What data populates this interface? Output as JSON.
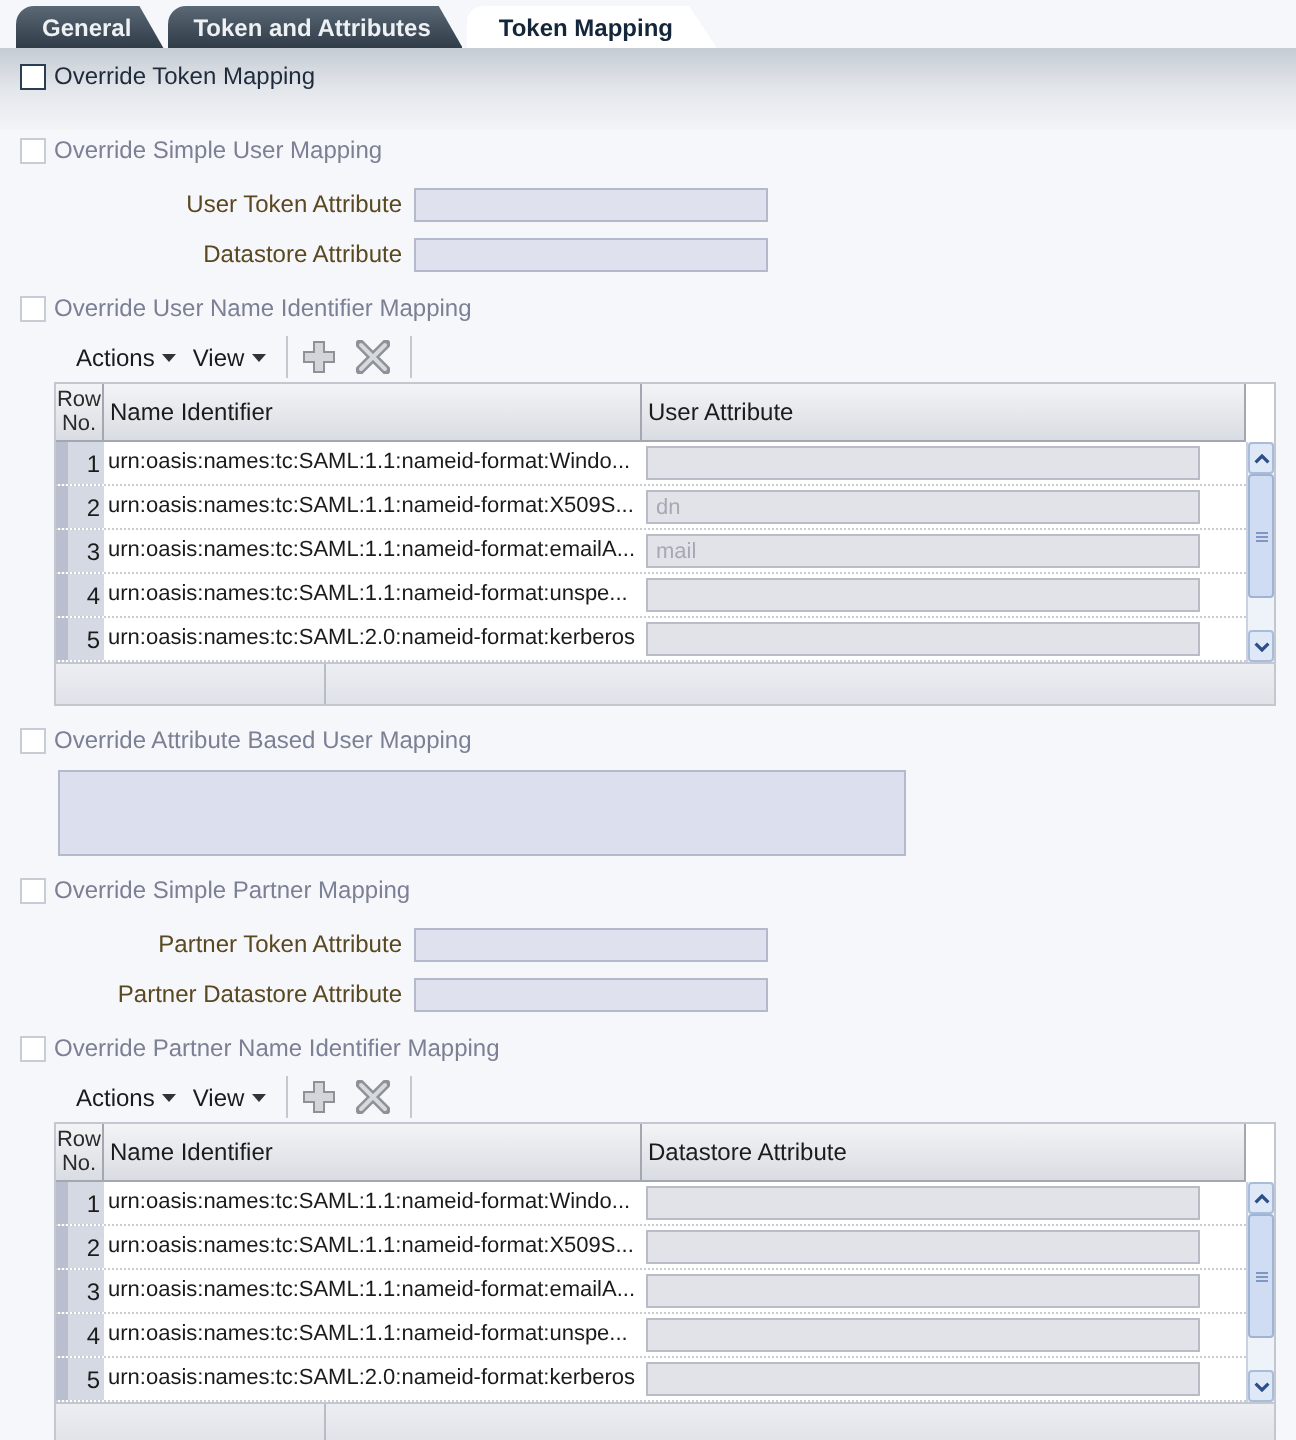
{
  "tabs": [
    {
      "label": "General",
      "selected": false
    },
    {
      "label": "Token and Attributes",
      "selected": false
    },
    {
      "label": "Token Mapping",
      "selected": true
    }
  ],
  "header": {
    "label": "Override Token Mapping",
    "checked": false,
    "disabled": false
  },
  "sections": [
    {
      "kind": "fields",
      "label": "Override Simple User Mapping",
      "checked": false,
      "disabled": true,
      "fields": [
        {
          "label": "User Token Attribute"
        },
        {
          "label": "Datastore Attribute"
        }
      ]
    },
    {
      "kind": "table",
      "label": "Override User Name Identifier Mapping",
      "checked": false,
      "disabled": true,
      "toolbar": {
        "menus": [
          {
            "label": "Actions"
          },
          {
            "label": "View"
          }
        ]
      },
      "table": {
        "columns": [
          "Row No.",
          "Name Identifier",
          "User Attribute"
        ],
        "rows": [
          {
            "row_no": "1",
            "name_identifier": "urn:oasis:names:tc:SAML:1.1:nameid-format:Windo..."
          },
          {
            "row_no": "2",
            "name_identifier": "urn:oasis:names:tc:SAML:1.1:nameid-format:X509S...",
            "value": "dn"
          },
          {
            "row_no": "3",
            "name_identifier": "urn:oasis:names:tc:SAML:1.1:nameid-format:emailA...",
            "value": "mail"
          },
          {
            "row_no": "4",
            "name_identifier": "urn:oasis:names:tc:SAML:1.1:nameid-format:unspe..."
          },
          {
            "row_no": "5",
            "name_identifier": "urn:oasis:names:tc:SAML:2.0:nameid-format:kerberos"
          }
        ]
      }
    },
    {
      "kind": "textarea",
      "label": "Override Attribute Based User Mapping",
      "checked": false,
      "disabled": true
    },
    {
      "kind": "fields",
      "label": "Override Simple Partner Mapping",
      "checked": false,
      "disabled": true,
      "fields": [
        {
          "label": "Partner Token Attribute"
        },
        {
          "label": "Partner Datastore Attribute"
        }
      ]
    },
    {
      "kind": "table",
      "label": "Override Partner Name Identifier Mapping",
      "checked": false,
      "disabled": true,
      "toolbar": {
        "menus": [
          {
            "label": "Actions"
          },
          {
            "label": "View"
          }
        ]
      },
      "table": {
        "columns": [
          "Row No.",
          "Name Identifier",
          "Datastore Attribute"
        ],
        "rows": [
          {
            "row_no": "1",
            "name_identifier": "urn:oasis:names:tc:SAML:1.1:nameid-format:Windo..."
          },
          {
            "row_no": "2",
            "name_identifier": "urn:oasis:names:tc:SAML:1.1:nameid-format:X509S..."
          },
          {
            "row_no": "3",
            "name_identifier": "urn:oasis:names:tc:SAML:1.1:nameid-format:emailA..."
          },
          {
            "row_no": "4",
            "name_identifier": "urn:oasis:names:tc:SAML:1.1:nameid-format:unspe..."
          },
          {
            "row_no": "5",
            "name_identifier": "urn:oasis:names:tc:SAML:2.0:nameid-format:kerberos"
          }
        ]
      }
    }
  ]
}
